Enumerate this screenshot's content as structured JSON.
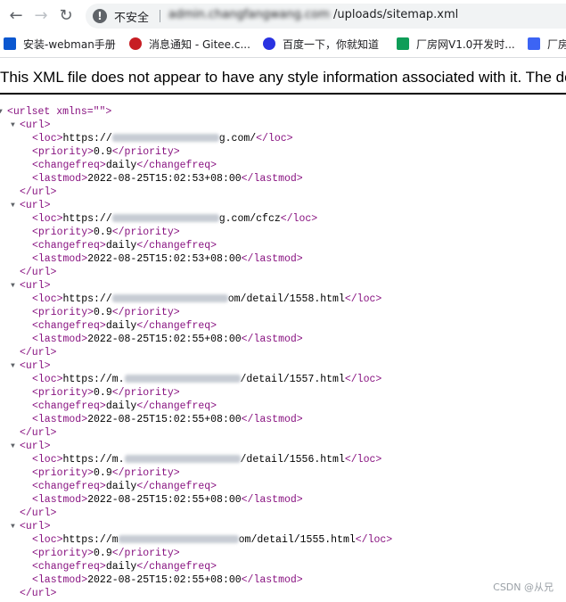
{
  "browser": {
    "back_icon": "arrow-left-icon",
    "forward_icon": "arrow-right-icon",
    "reload_icon": "reload-icon",
    "security_label": "不安全",
    "url_host": "admin.changfangwang.com",
    "url_path": "/uploads/sitemap.xml"
  },
  "bookmarks": [
    {
      "label": "安装-webman手册",
      "icon_color": "#0b57d0"
    },
    {
      "label": "消息通知 - Gitee.c...",
      "icon_color": "#c71d23"
    },
    {
      "label": "百度一下，你就知道",
      "icon_color": "#2932e1"
    },
    {
      "label": "厂房网V1.0开发时...",
      "icon_color": "#0f9d58"
    },
    {
      "label": "厂房",
      "icon_color": "#3c64f4"
    }
  ],
  "notice": "This XML file does not appear to have any style information associated with it. The document tree is shown below.",
  "xml": {
    "urlset_open": "<urlset xmlns=\"\">",
    "url_open": "<url>",
    "url_close": "</url>",
    "entries": [
      {
        "loc_pre": "https://",
        "loc_post": "g.com/",
        "priority": "0.9",
        "changefreq": "daily",
        "lastmod": "2022-08-25T15:02:53+08:00"
      },
      {
        "loc_pre": "https://",
        "loc_post": "g.com/cfcz",
        "priority": "0.9",
        "changefreq": "daily",
        "lastmod": "2022-08-25T15:02:53+08:00"
      },
      {
        "loc_pre": "https://",
        "loc_post": "om/detail/1558.html",
        "priority": "0.9",
        "changefreq": "daily",
        "lastmod": "2022-08-25T15:02:55+08:00"
      },
      {
        "loc_pre": "https://m.",
        "loc_post": "/detail/1557.html",
        "priority": "0.9",
        "changefreq": "daily",
        "lastmod": "2022-08-25T15:02:55+08:00"
      },
      {
        "loc_pre": "https://m.",
        "loc_post": "/detail/1556.html",
        "priority": "0.9",
        "changefreq": "daily",
        "lastmod": "2022-08-25T15:02:55+08:00"
      },
      {
        "loc_pre": "https://m",
        "loc_post": "om/detail/1555.html",
        "priority": "0.9",
        "changefreq": "daily",
        "lastmod": "2022-08-25T15:02:55+08:00"
      }
    ]
  },
  "watermark": "CSDN @从兄"
}
